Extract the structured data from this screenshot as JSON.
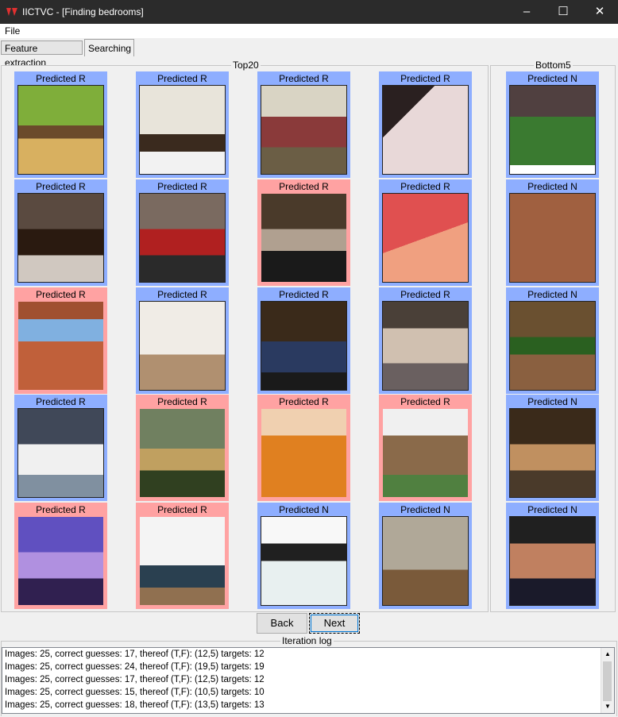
{
  "window": {
    "title": "IICTVC - [Finding bedrooms]",
    "minimize": "–",
    "maximize": "☐",
    "close": "✕"
  },
  "menu": {
    "file": "File"
  },
  "tabs": [
    "Feature extraction",
    "Searching"
  ],
  "top20": {
    "title": "Top20",
    "tiles": [
      {
        "label": "Predicted R",
        "status": "blue",
        "thumbnail": "bedroom-green-wall"
      },
      {
        "label": "Predicted R",
        "status": "blue",
        "thumbnail": "bedroom-ceiling-fan"
      },
      {
        "label": "Predicted R",
        "status": "blue",
        "thumbnail": "bedroom-messy"
      },
      {
        "label": "Predicted R",
        "status": "blue",
        "thumbnail": "bed-laptop"
      },
      {
        "label": "Predicted R",
        "status": "blue",
        "thumbnail": "bedroom-dark-furniture"
      },
      {
        "label": "Predicted R",
        "status": "blue",
        "thumbnail": "bedroom-red-bedding"
      },
      {
        "label": "Predicted R",
        "status": "red",
        "thumbnail": "living-room-fireplace"
      },
      {
        "label": "Predicted R",
        "status": "blue",
        "thumbnail": "girl-jumping-red-room"
      },
      {
        "label": "Predicted R",
        "status": "red",
        "thumbnail": "canyon-sandstone"
      },
      {
        "label": "Predicted R",
        "status": "blue",
        "thumbnail": "white-bedroom"
      },
      {
        "label": "Predicted R",
        "status": "blue",
        "thumbnail": "bedroom-dark-lamp"
      },
      {
        "label": "Predicted R",
        "status": "blue",
        "thumbnail": "person-in-bed"
      },
      {
        "label": "Predicted R",
        "status": "blue",
        "thumbnail": "modern-bedroom-striped"
      },
      {
        "label": "Predicted R",
        "status": "red",
        "thumbnail": "rainbow-hills"
      },
      {
        "label": "Predicted R",
        "status": "red",
        "thumbnail": "fried-croquettes"
      },
      {
        "label": "Predicted R",
        "status": "red",
        "thumbnail": "old-mansion"
      },
      {
        "label": "Predicted R",
        "status": "red",
        "thumbnail": "bus-interior-purple"
      },
      {
        "label": "Predicted R",
        "status": "red",
        "thumbnail": "basement-living-room"
      },
      {
        "label": "Predicted N",
        "status": "blue",
        "thumbnail": "white-hallway"
      },
      {
        "label": "Predicted N",
        "status": "blue",
        "thumbnail": "empty-room-kitchen"
      }
    ]
  },
  "bottom5": {
    "title": "Bottom5",
    "tiles": [
      {
        "label": "Predicted N",
        "status": "blue",
        "thumbnail": "baseball-stadium"
      },
      {
        "label": "Predicted N",
        "status": "blue",
        "thumbnail": "baseball-batter"
      },
      {
        "label": "Predicted N",
        "status": "blue",
        "thumbnail": "crowded-hall"
      },
      {
        "label": "Predicted N",
        "status": "blue",
        "thumbnail": "banquet-hall"
      },
      {
        "label": "Predicted N",
        "status": "blue",
        "thumbnail": "boxing-match"
      }
    ]
  },
  "buttons": {
    "back": "Back",
    "next": "Next"
  },
  "log": {
    "title": "Iteration log",
    "lines": [
      "Images: 25, correct guesses: 17, thereof (T,F): (12,5) targets: 12",
      "Images: 25, correct guesses: 24, thereof (T,F): (19,5) targets: 19",
      "Images: 25, correct guesses: 17, thereof (T,F): (12,5) targets: 12",
      "Images: 25, correct guesses: 15, thereof (T,F): (10,5) targets: 10",
      "Images: 25, correct guesses: 18, thereof (T,F): (13,5) targets: 13"
    ]
  },
  "colors": {
    "relevant_bg": "#8eaeff",
    "irrelevant_bg": "#ffa2a2"
  }
}
